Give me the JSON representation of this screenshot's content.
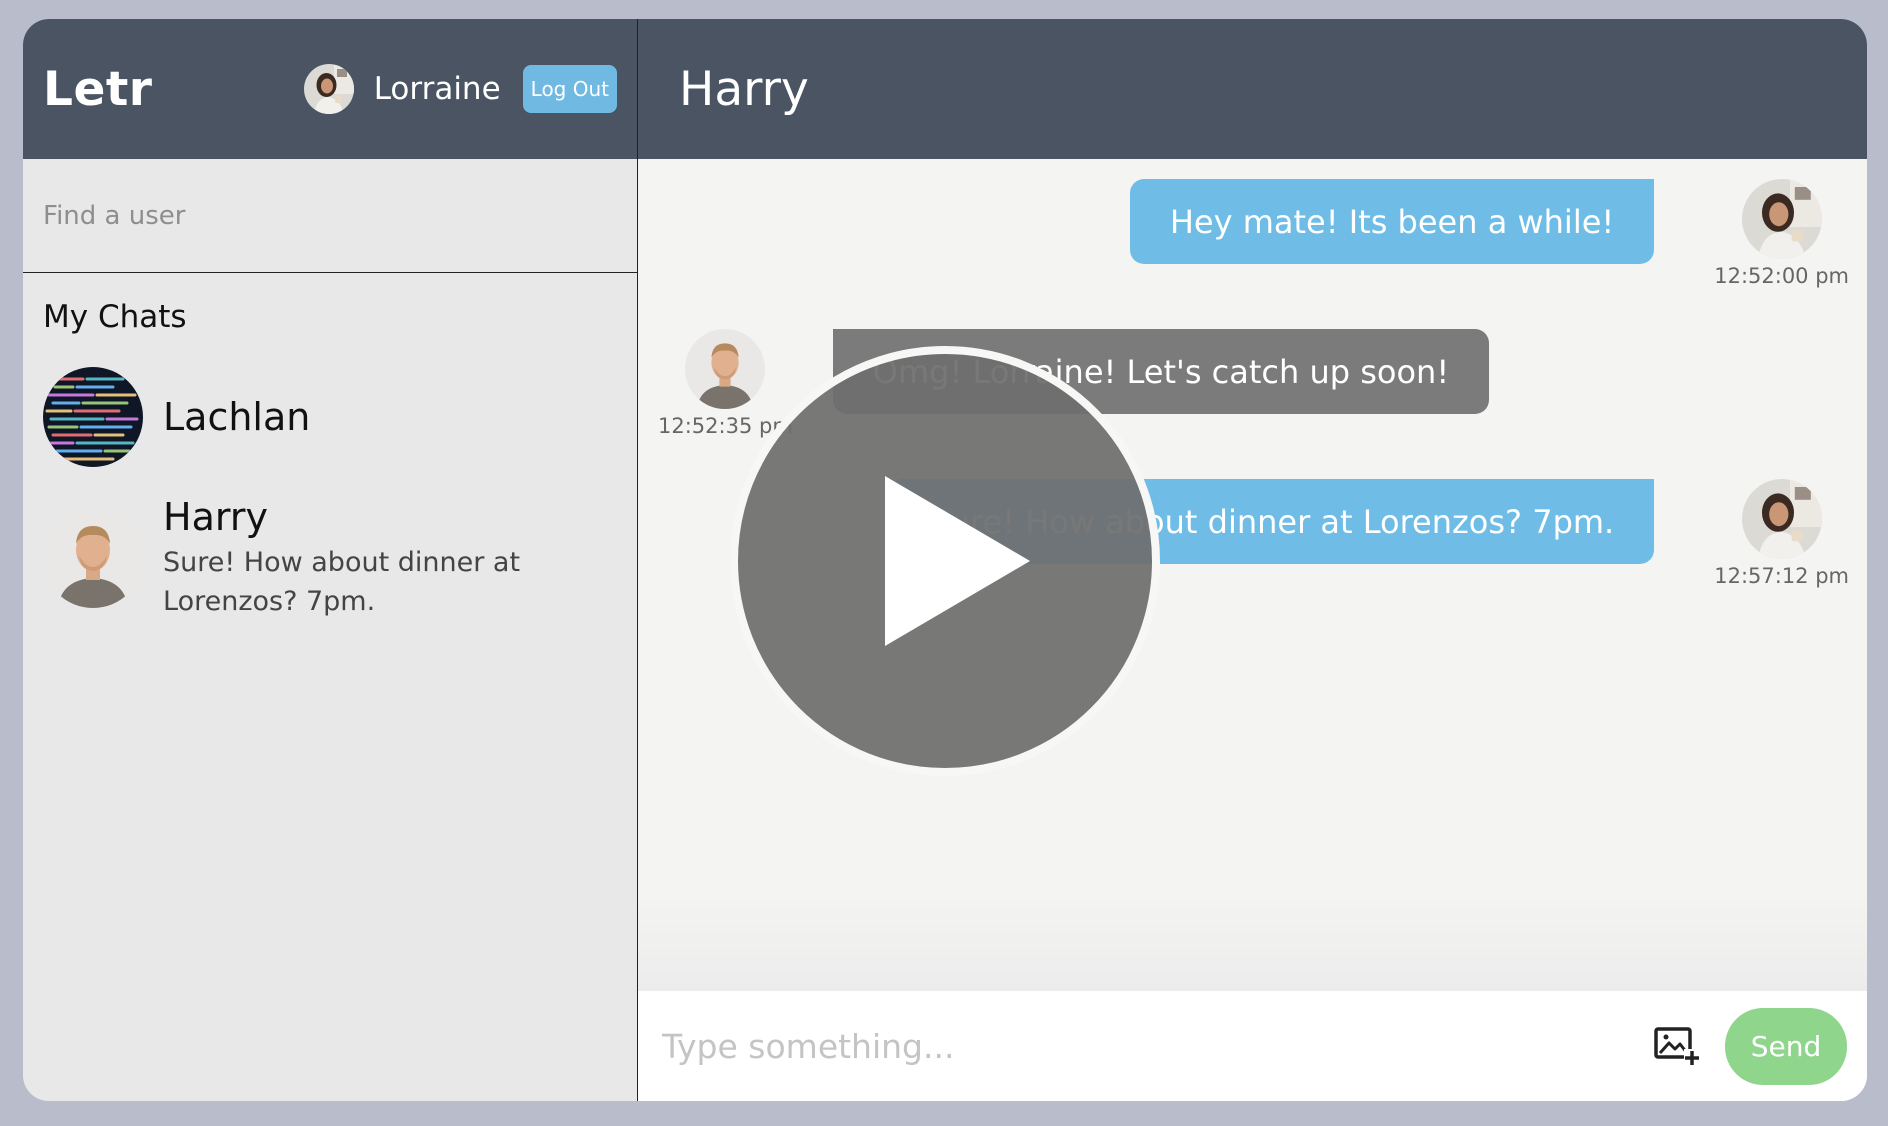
{
  "sidebar": {
    "brand": "Letr",
    "current_user": {
      "name": "Lorraine"
    },
    "logout_label": "Log Out",
    "search_placeholder": "Find a user",
    "chats_title": "My Chats",
    "chats": [
      {
        "name": "Lachlan",
        "last_message": ""
      },
      {
        "name": "Harry",
        "last_message": "Sure! How about dinner at Lorenzos? 7pm."
      }
    ]
  },
  "main": {
    "chat_title": "Harry",
    "messages": [
      {
        "from": "Lorraine",
        "text": "Hey mate! Its been a while!",
        "time": "12:52:00 pm",
        "mine": true
      },
      {
        "from": "Harry",
        "text": "Omg! Lorraine! Let's catch up soon!",
        "time": "12:52:35 pm",
        "mine": false
      },
      {
        "from": "Lorraine",
        "text": "Sure! How about dinner at Lorenzos? 7pm.",
        "time": "12:57:12 pm",
        "mine": true
      }
    ],
    "composer": {
      "placeholder": "Type something...",
      "send_label": "Send"
    }
  },
  "colors": {
    "header_bg": "#4a5463",
    "my_bubble": "#6fbde6",
    "their_bubble": "#7b7b7b",
    "send_button": "#8fd68c",
    "logout_button": "#6fb9e2"
  },
  "icons": [
    "add-image-icon",
    "play-icon"
  ]
}
